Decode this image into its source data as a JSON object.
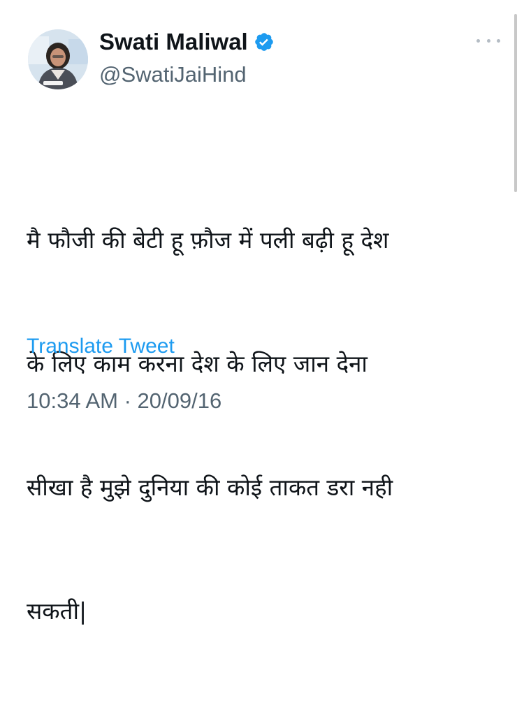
{
  "tweet": {
    "author": {
      "display_name": "Swati Maliwal",
      "handle": "@SwatiJaiHind",
      "verified": true
    },
    "text_lines": [
      "मै फौजी की बेटी हू फ़ौज में पली बढ़ी हू देश",
      "के लिए काम करना देश के लिए जान देना",
      "सीखा है मुझे दुनिया की कोई ताकत डरा नही",
      "सकती|"
    ],
    "translate_label": "Translate Tweet",
    "timestamp": "10:34 AM · 20/09/16"
  },
  "colors": {
    "link": "#1d9bf0",
    "secondary_text": "#536471",
    "primary_text": "#0f1419",
    "verified_badge": "#1d9bf0"
  },
  "icons": {
    "verified": "verified-badge-icon",
    "more": "more-options-icon"
  }
}
